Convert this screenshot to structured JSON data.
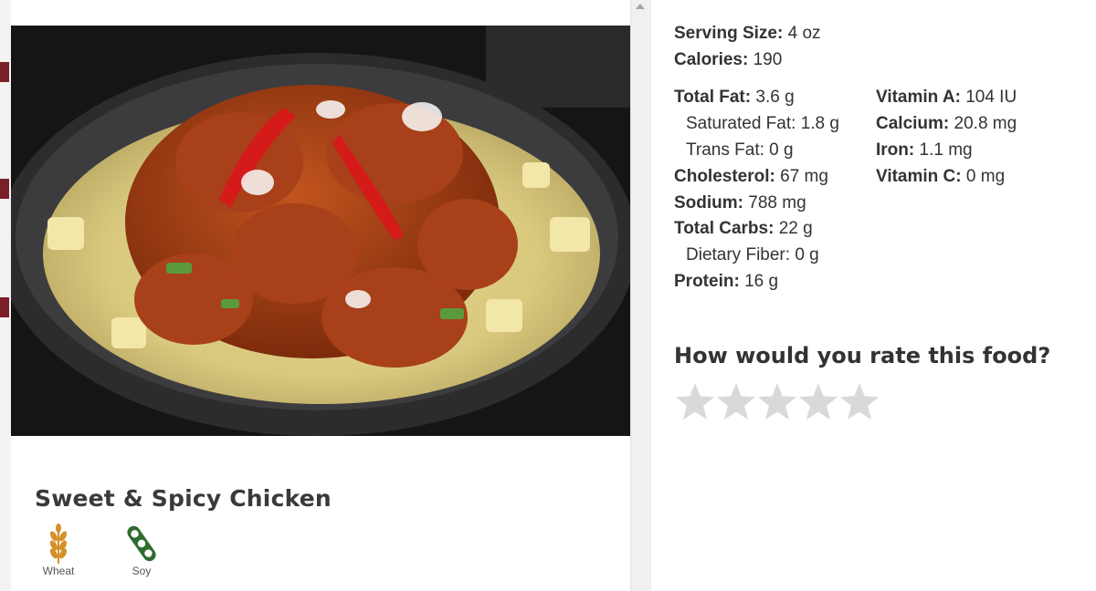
{
  "food": {
    "title": "Sweet & Spicy Chicken",
    "allergens": [
      {
        "label": "Wheat",
        "icon": "wheat-icon",
        "color": "#d4902a"
      },
      {
        "label": "Soy",
        "icon": "soy-icon",
        "color": "#2e6b2f"
      }
    ]
  },
  "nutrition": {
    "serving_size": {
      "label": "Serving Size:",
      "value": "4 oz"
    },
    "calories": {
      "label": "Calories:",
      "value": "190"
    },
    "left_column": [
      {
        "label": "Total Fat:",
        "value": "3.6 g",
        "bold": true
      },
      {
        "label": "Saturated Fat:",
        "value": "1.8 g",
        "bold": false
      },
      {
        "label": "Trans Fat:",
        "value": "0 g",
        "bold": false
      },
      {
        "label": "Cholesterol:",
        "value": "67 mg",
        "bold": true
      },
      {
        "label": "Sodium:",
        "value": "788 mg",
        "bold": true
      },
      {
        "label": "Total Carbs:",
        "value": "22 g",
        "bold": true
      },
      {
        "label": "Dietary Fiber:",
        "value": "0 g",
        "bold": false
      },
      {
        "label": "Protein:",
        "value": "16 g",
        "bold": true
      }
    ],
    "right_column": [
      {
        "label": "Vitamin A:",
        "value": "104 IU"
      },
      {
        "label": "Calcium:",
        "value": "20.8 mg"
      },
      {
        "label": "Iron:",
        "value": "1.1 mg"
      },
      {
        "label": "Vitamin C:",
        "value": "0 mg"
      }
    ]
  },
  "rating": {
    "prompt": "How would you rate this food?",
    "stars_total": 5,
    "stars_selected": 0,
    "star_color": "#d9d9d9"
  }
}
